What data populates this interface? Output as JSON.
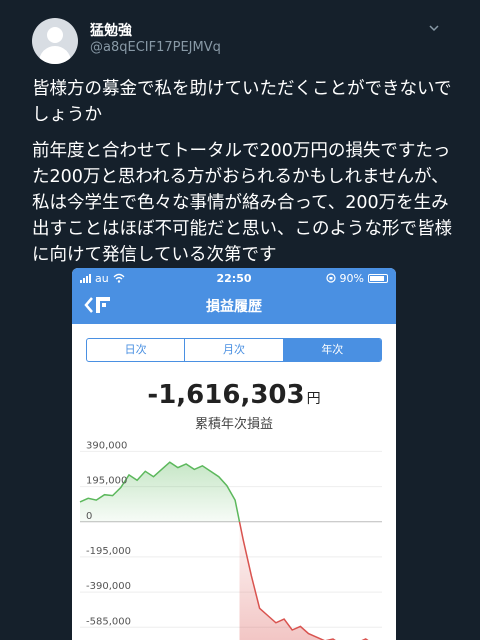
{
  "tweet": {
    "display_name": "猛勉強",
    "handle": "@a8qECIF17PEJMVq",
    "paragraph1": "皆様方の募金で私を助けていただくことができないでしょうか",
    "paragraph2": "前年度と合わせてトータルで200万円の損失ですたった200万と思われる方がおられるかもしれませんが、私は今学生で色々な事情が絡み合って、200万を生み出すことはほぼ不可能だと思い、このような形で皆様に向けて発信している次第です"
  },
  "phone": {
    "carrier": "au",
    "time": "22:50",
    "battery": "90%",
    "title": "損益履歴",
    "tabs": [
      {
        "label": "日次",
        "active": false
      },
      {
        "label": "月次",
        "active": false
      },
      {
        "label": "年次",
        "active": true
      }
    ],
    "amount": "-1,616,303",
    "amount_unit": "円",
    "amount_label": "累積年次損益"
  },
  "chart_data": {
    "type": "area",
    "title": "",
    "xlabel": "",
    "ylabel": "",
    "ytick_labels": [
      "390,000",
      "195,000",
      "0",
      "-195,000",
      "-390,000",
      "-585,000"
    ],
    "yticks": [
      390000,
      195000,
      0,
      -195000,
      -390000,
      -585000
    ],
    "ylim": [
      -700000,
      420000
    ],
    "grid": true,
    "colors": {
      "positive": "#5cb85c",
      "negative": "#d9534f"
    },
    "values": [
      110000,
      130000,
      120000,
      150000,
      145000,
      190000,
      260000,
      230000,
      280000,
      250000,
      290000,
      330000,
      300000,
      320000,
      290000,
      310000,
      280000,
      250000,
      200000,
      120000,
      -100000,
      -300000,
      -480000,
      -520000,
      -560000,
      -540000,
      -600000,
      -580000,
      -620000,
      -640000,
      -660000,
      -650000,
      -680000,
      -660000,
      -670000,
      -650000,
      -680000,
      -690000
    ]
  }
}
